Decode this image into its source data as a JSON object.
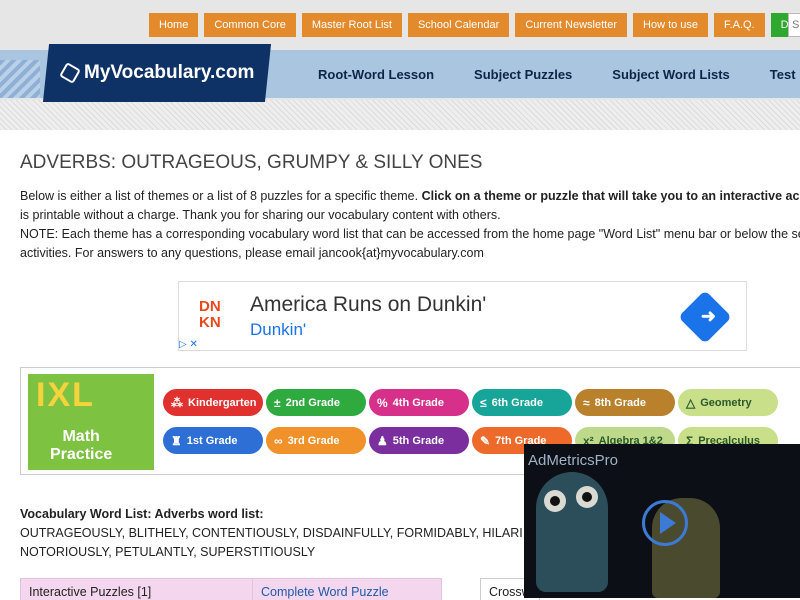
{
  "topnav": [
    {
      "label": "Home"
    },
    {
      "label": "Common Core"
    },
    {
      "label": "Master Root List"
    },
    {
      "label": "School Calendar"
    },
    {
      "label": "Current Newsletter"
    },
    {
      "label": "How to use"
    },
    {
      "label": "F.A.Q."
    },
    {
      "label": "Donate"
    }
  ],
  "search": {
    "placeholder": "S"
  },
  "logo": {
    "text": "MyVocabulary.com"
  },
  "mainnav": [
    {
      "label": "Root-Word Lesson"
    },
    {
      "label": "Subject Puzzles"
    },
    {
      "label": "Subject Word Lists"
    },
    {
      "label": "Test Pre"
    }
  ],
  "page": {
    "title": "ADVERBS: OUTRAGEOUS, GRUMPY & SILLY ONES",
    "intro_line1_plain": "Below is either a list of themes or a list of 8 puzzles for a specific theme. ",
    "intro_line1_bold": "Click on a theme or puzzle that will take you to an interactive ac",
    "intro_line2": "is printable without a charge. Thank you for sharing our vocabulary content with others.",
    "intro_line3": "NOTE: Each theme has a corresponding vocabulary word list that can be accessed from the home page \"Word List\" menu bar or below the se",
    "intro_line4": "activities. For answers to any questions, please email jancook{at}myvocabulary.com"
  },
  "ad_dunkin": {
    "brand_top": "DN",
    "brand_bottom": "KN",
    "headline": "America Runs on Dunkin'",
    "advertiser": "Dunkin'",
    "adchoices": "▷ ✕"
  },
  "ad_ixl": {
    "logo": "IXL",
    "tagline_1": "Math",
    "tagline_2": "Practice",
    "grades": [
      {
        "label": "Kindergarten",
        "icon": "⁂",
        "color": "#e0312f"
      },
      {
        "label": "2nd Grade",
        "icon": "±",
        "color": "#2faa3f"
      },
      {
        "label": "4th Grade",
        "icon": "%",
        "color": "#d6308a"
      },
      {
        "label": "6th Grade",
        "icon": "≤",
        "color": "#17a59a"
      },
      {
        "label": "8th Grade",
        "icon": "≈",
        "color": "#b9812c"
      },
      {
        "label": "Geometry",
        "icon": "△",
        "color": "#c9df8a"
      },
      {
        "label": "1st Grade",
        "icon": "♜",
        "color": "#2e6fd6"
      },
      {
        "label": "3rd Grade",
        "icon": "∞",
        "color": "#f0912a"
      },
      {
        "label": "5th Grade",
        "icon": "♟",
        "color": "#7b2f9e"
      },
      {
        "label": "7th Grade",
        "icon": "✎",
        "color": "#ee6a2b"
      },
      {
        "label": "Algebra 1&2",
        "icon": "x²",
        "color": "#bfd98a"
      },
      {
        "label": "Precalculus",
        "icon": "Σ",
        "color": "#c9df8a"
      }
    ]
  },
  "wordlist": {
    "heading": "Vocabulary Word List: Adverbs word list:",
    "line1": "OUTRAGEOUSLY, BLITHELY, CONTENTIOUSLY, DISDAINFULLY, FORMIDABLY, HILARI",
    "line2": "NOTORIOUSLY, PETULANTLY, SUPERSTITIOUSLY"
  },
  "puzzles": {
    "col1": "Interactive Puzzles [1]",
    "col2": "Complete Word Puzzle",
    "cross": "Crossw"
  },
  "video_ad": {
    "brand": "AdMetricsPro"
  }
}
